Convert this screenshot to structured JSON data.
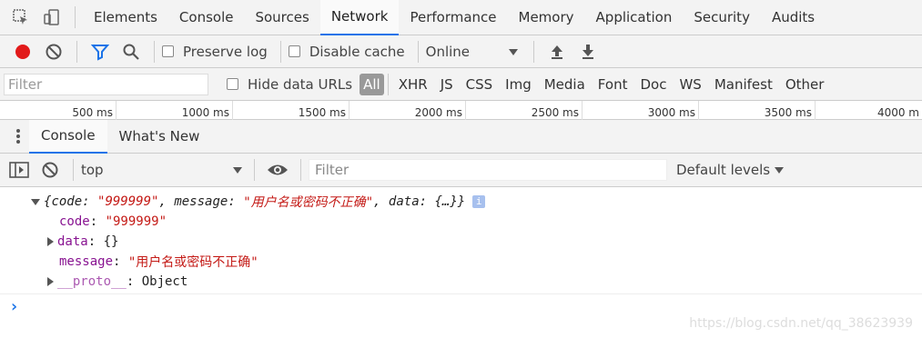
{
  "tabs": {
    "items": [
      "Elements",
      "Console",
      "Sources",
      "Network",
      "Performance",
      "Memory",
      "Application",
      "Security",
      "Audits"
    ],
    "active": "Network"
  },
  "network_toolbar": {
    "preserve_log": "Preserve log",
    "disable_cache": "Disable cache",
    "throttle": "Online",
    "record_color": "#e21a1a",
    "filter_icon_color": "#1a73e8"
  },
  "filter_bar": {
    "placeholder": "Filter",
    "hide_data_urls": "Hide data URLs",
    "types": [
      "All",
      "XHR",
      "JS",
      "CSS",
      "Img",
      "Media",
      "Font",
      "Doc",
      "WS",
      "Manifest",
      "Other"
    ],
    "active_type": "All"
  },
  "timeline": {
    "ticks": [
      "500 ms",
      "1000 ms",
      "1500 ms",
      "2000 ms",
      "2500 ms",
      "3000 ms",
      "3500 ms",
      "4000 m"
    ]
  },
  "drawer": {
    "tabs": [
      "Console",
      "What's New"
    ],
    "active": "Console"
  },
  "console_toolbar": {
    "context": "top",
    "filter_placeholder": "Filter",
    "levels": "Default levels"
  },
  "output": {
    "summary_open": "{",
    "summary_code_key": "code",
    "summary_code_val": "\"999999\"",
    "summary_msg_key": "message",
    "summary_msg_val": "\"用户名或密码不正确\"",
    "summary_data_key": "data",
    "summary_data_val": "{…}}",
    "info_badge": "i",
    "code_key": "code",
    "code_val": "\"999999\"",
    "data_key": "data",
    "data_val": "{}",
    "message_key": "message",
    "message_val": "\"用户名或密码不正确\"",
    "proto_key": "__proto__",
    "proto_val": "Object",
    "prompt": "›"
  },
  "watermark": "https://blog.csdn.net/qq_38623939"
}
